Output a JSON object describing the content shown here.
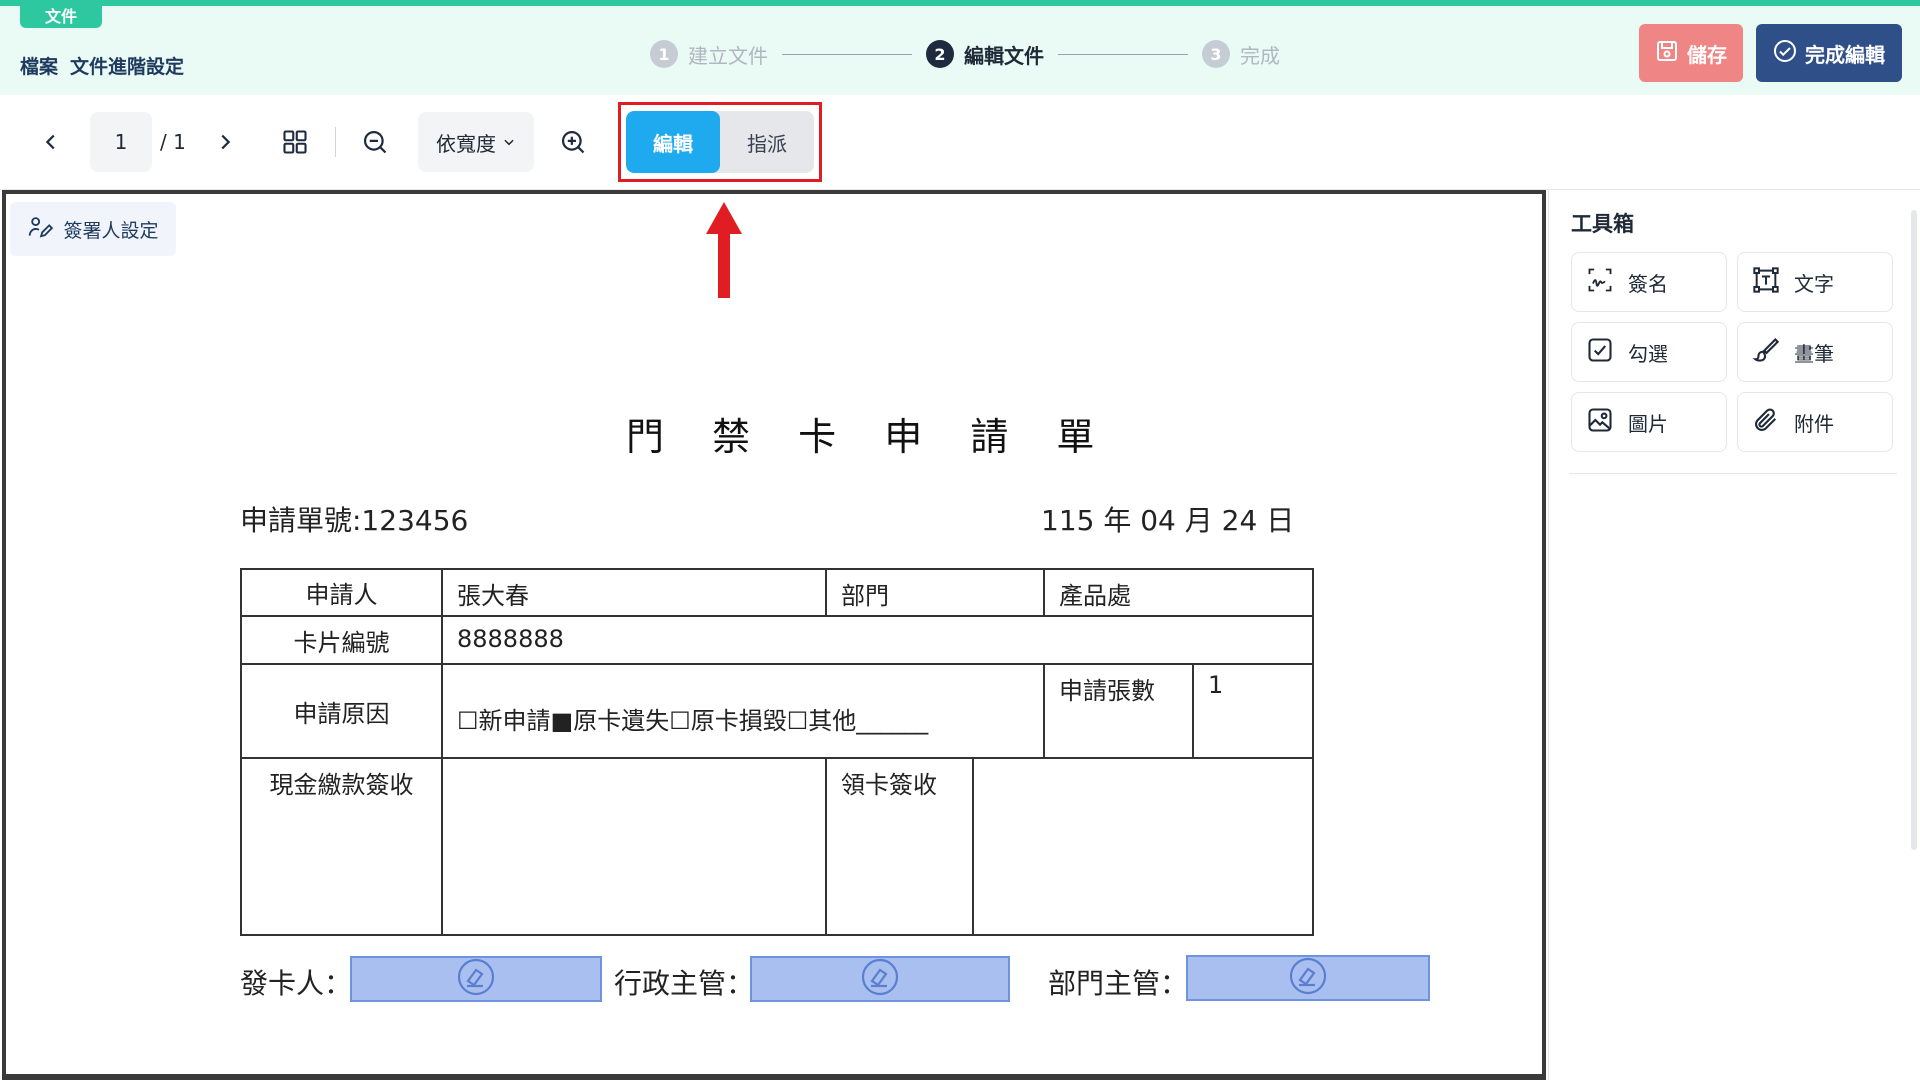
{
  "header": {
    "file_tag": "文件",
    "breadcrumb": [
      "檔案",
      "文件進階設定"
    ],
    "steps": [
      {
        "num": "1",
        "label": "建立文件",
        "state": "done"
      },
      {
        "num": "2",
        "label": "編輯文件",
        "state": "active"
      },
      {
        "num": "3",
        "label": "完成",
        "state": "pending"
      }
    ],
    "save_label": "儲存",
    "finish_label": "完成編輯",
    "colors": {
      "accent": "#2ec8a0",
      "save": "#f08585",
      "finish": "#2e4f88"
    }
  },
  "toolbar": {
    "prev_icon": "chevron-left-icon",
    "next_icon": "chevron-right-icon",
    "page_current": "1",
    "page_total": "/ 1",
    "grid_icon": "grid-icon",
    "zoom_out_icon": "zoom-out-icon",
    "zoom_mode": "依寬度",
    "zoom_in_icon": "zoom-in-icon",
    "mode_edit": "編輯",
    "mode_assign": "指派",
    "active_mode": "編輯",
    "active_color": "#1fa9ee"
  },
  "canvas": {
    "signer_button": "簽署人設定",
    "document": {
      "title": "門 禁 卡 申 請 單",
      "application_no": "申請單號:123456",
      "date": "115 年 04 月 24 日",
      "table": {
        "applicant_label": "申請人",
        "applicant_value": "張大春",
        "dept_label": "部門",
        "dept_value": "產品處",
        "card_no_label": "卡片編號",
        "card_no_value": "8888888",
        "reason_label": "申請原因",
        "reason_value": "☐新申請■原卡遺失☐原卡損毀☐其他______",
        "count_label": "申請張數",
        "count_value": "1",
        "cash_label": "現金繳款簽收",
        "receive_label": "領卡簽收"
      },
      "signatures": [
        {
          "label": "發卡人：",
          "icon": "stamp-icon"
        },
        {
          "label": "行政主管：",
          "icon": "stamp-icon"
        },
        {
          "label": "部門主管：",
          "icon": "stamp-icon"
        }
      ]
    }
  },
  "toolbox": {
    "title": "工具箱",
    "tools": [
      {
        "label": "簽名",
        "icon": "signature-icon"
      },
      {
        "label": "文字",
        "icon": "text-box-icon"
      },
      {
        "label": "勾選",
        "icon": "checkbox-icon"
      },
      {
        "label": "畫筆",
        "icon": "brush-icon"
      },
      {
        "label": "圖片",
        "icon": "image-icon"
      },
      {
        "label": "附件",
        "icon": "paperclip-icon"
      }
    ]
  }
}
